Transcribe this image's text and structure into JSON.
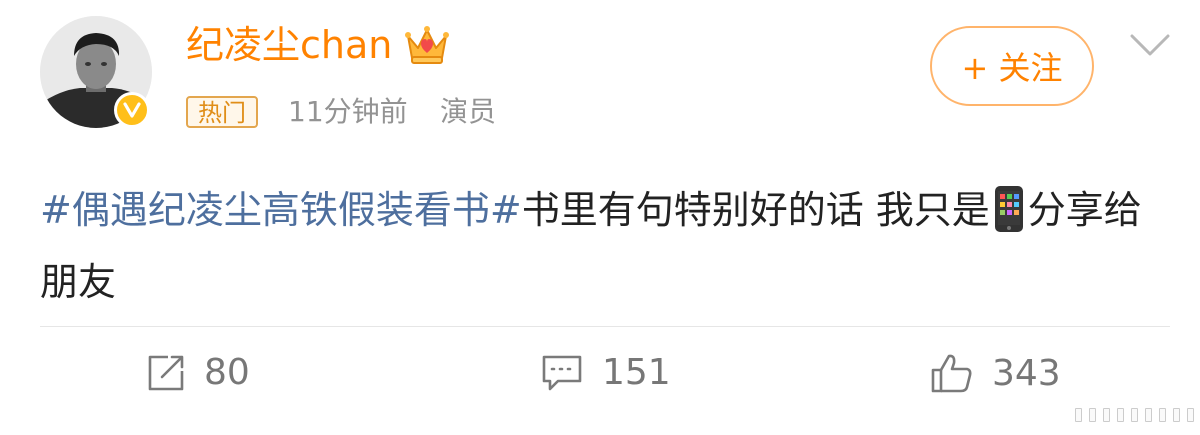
{
  "user": {
    "name": "纪凌尘chan",
    "hot_tag": "热门",
    "time": "11分钟前",
    "role": "演员",
    "verified_badge": "verified-v-icon",
    "follow_label": "+ 关注"
  },
  "post": {
    "topic": "#偶遇纪凌尘高铁假装看书#",
    "text_part1": "书里有句特别好的话  我只是",
    "emoji": "mobile-phone-icon",
    "text_part2": "分享给朋友"
  },
  "actions": {
    "repost_count": "80",
    "comment_count": "151",
    "like_count": "343"
  },
  "colors": {
    "username": "#ff8200",
    "topic_link": "#4e6f9e",
    "verified": "#ffbf1a"
  }
}
